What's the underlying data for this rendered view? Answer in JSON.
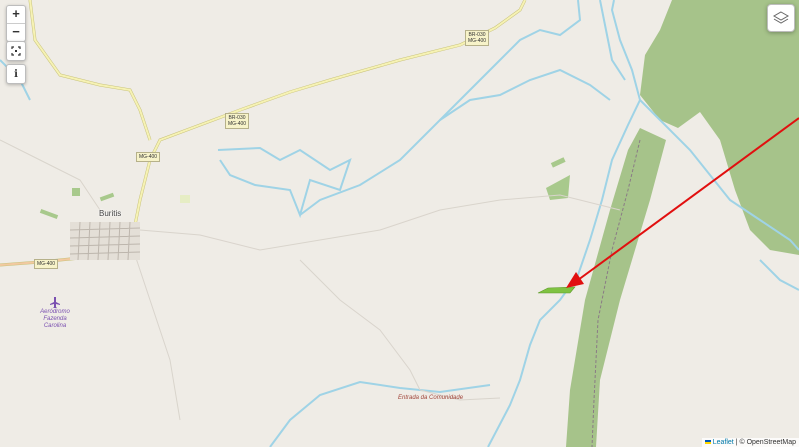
{
  "controls": {
    "zoom_in": "+",
    "zoom_out": "−",
    "fullscreen_icon": "fullscreen-icon",
    "info_icon": "info-icon",
    "info_label": "i",
    "layers_icon": "layers-icon"
  },
  "labels": {
    "town": "Buritis",
    "airport_line1": "Aeródromo",
    "airport_line2": "Fazenda",
    "airport_line3": "Carolina",
    "entrada": "Entrada da Comunidade"
  },
  "shields": {
    "br030_a": "BR-030",
    "br030_b": "MG-400",
    "br030c_a": "BR-030",
    "br030c_b": "MG-400",
    "mg400_1": "MG-400",
    "mg400_2": "MG-400"
  },
  "attribution": {
    "leaflet": "Leaflet",
    "osm": "| © OpenStreetMap"
  },
  "colors": {
    "background": "#efece6",
    "forest": "#a6c38a",
    "river": "#9fd3e6",
    "road_primary": "#f3efa6",
    "arrow": "#e10f0f",
    "highlight_polygon": "#7fc241"
  }
}
